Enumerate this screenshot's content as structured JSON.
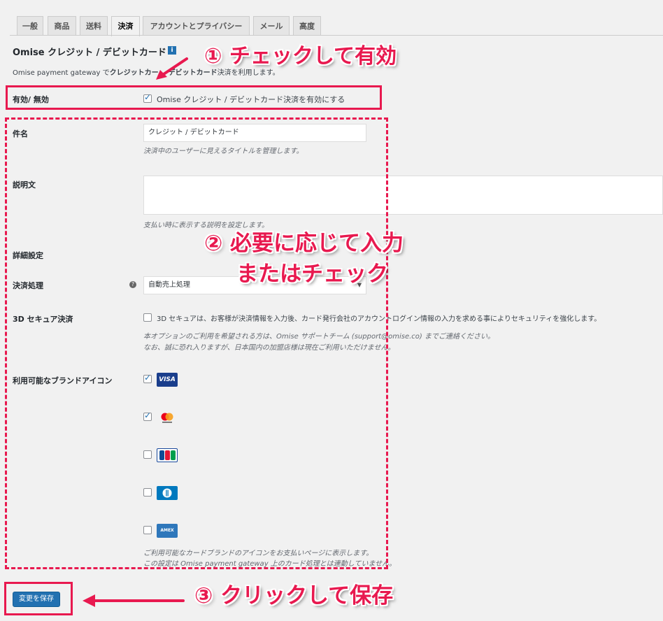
{
  "tabs": [
    "一般",
    "商品",
    "送料",
    "決済",
    "アカウントとプライバシー",
    "メール",
    "高度"
  ],
  "section": {
    "title": "Omise クレジット / デビットカード",
    "title_badge": "i",
    "subtitle_prefix": "Omise payment gateway で",
    "subtitle_bold": "クレジットカー",
    "subtitle_rest": "デビットカード",
    "subtitle_tail": "決済を利用します。"
  },
  "fields": {
    "enable_label": "有効/ 無効",
    "enable_text": "Omise クレジット / デビットカード決済を有効にする",
    "title_label": "件名",
    "title_value": "クレジット / デビットカード",
    "title_desc": "決済中のユーザーに見えるタイトルを管理します。",
    "description_label": "説明文",
    "description_desc": "支払い時に表示する説明を設定します。",
    "advanced_label": "詳細設定",
    "payment_action_label": "決済処理",
    "payment_action_help": "?",
    "payment_action_value": "自動売上処理",
    "secure3d_label": "3D セキュア決済",
    "secure3d_text": "3D セキュアは、お客様が決済情報を入力後、カード発行会社のアカウントログイン情報の入力を求める事によりセキュリティを強化します。",
    "secure3d_desc1": "本オプションのご利用を希望される方は、Omise サポートチーム (support@omise.co) までご連絡ください。",
    "secure3d_desc2": "なお、誠に恐れ入りますが、日本国内の加盟店様は現在ご利用いただけません。",
    "brands_label": "利用可能なブランドアイコン",
    "brands_desc1": "ご利用可能なカードブランドのアイコンをお支払いページに表示します。",
    "brands_desc2": "この設定は Omise payment gateway 上のカード処理とは連動していません。"
  },
  "brands": [
    {
      "name": "VISA",
      "checked": true
    },
    {
      "name": "Mastercard",
      "checked": true
    },
    {
      "name": "JCB",
      "checked": false
    },
    {
      "name": "Diners",
      "checked": false
    },
    {
      "name": "AMEX",
      "checked": false
    }
  ],
  "save_button": "変更を保存",
  "callouts": {
    "step1": "① チェックして有効",
    "step2_line1": "② 必要に応じて入力",
    "step2_line2": "またはチェック",
    "step3": "③ クリックして保存"
  },
  "colors": {
    "accent": "#e8194f",
    "button": "#2271b1"
  }
}
